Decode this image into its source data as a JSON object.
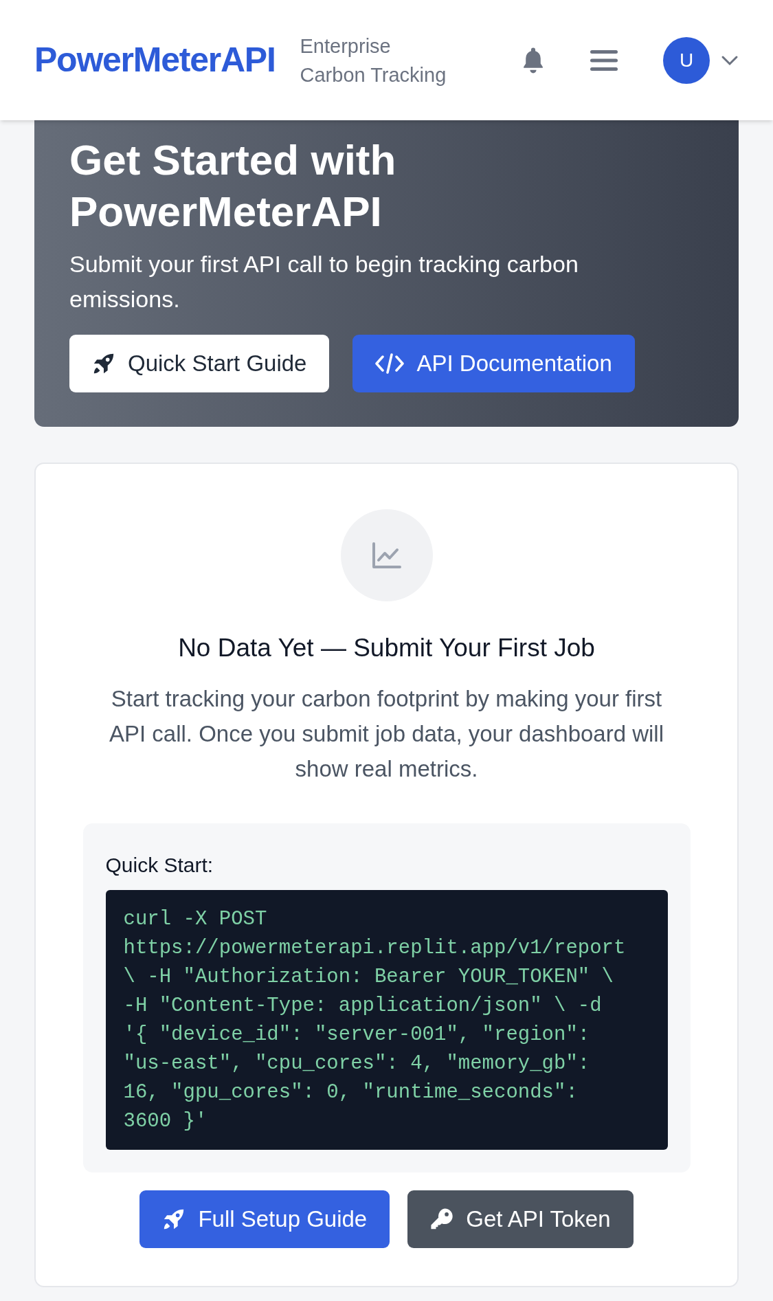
{
  "header": {
    "logo": "PowerMeterAPI",
    "subtitle_lines": [
      "Enterprise",
      "Carbon Tracking"
    ],
    "avatar": "U"
  },
  "hero": {
    "title_lines": [
      "Get Started with",
      "PowerMeterAPI"
    ],
    "subtitle": "Submit your first API call to begin tracking carbon emissions.",
    "buttons": [
      {
        "label": "Quick Start Guide",
        "kind": "light"
      },
      {
        "label": "API Documentation",
        "kind": "primary"
      }
    ]
  },
  "empty_state": {
    "heading": "No Data Yet — Submit Your First Job",
    "text": "Start tracking your carbon footprint by making your first API call. Once you submit job data, your dashboard will show real metrics.",
    "quick_start": {
      "label": "Quick Start:",
      "code": "curl -X POST https://powermeterapi.replit.app/v1/report \\ -H \"Authorization: Bearer YOUR_TOKEN\" \\ -H \"Content-Type: application/json\" \\ -d '{ \"device_id\": \"server-001\", \"region\": \"us-east\", \"cpu_cores\": 4, \"memory_gb\": 16, \"gpu_cores\": 0, \"runtime_seconds\": 3600 }'"
    },
    "buttons": [
      {
        "label": "Full Setup Guide",
        "kind": "primary"
      },
      {
        "label": "Get API Token",
        "kind": "dark"
      }
    ]
  }
}
